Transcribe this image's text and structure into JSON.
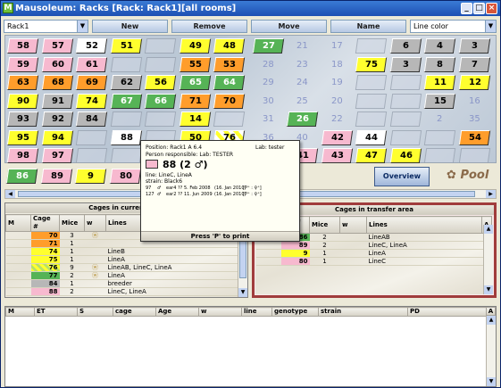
{
  "window": {
    "title": "Mausoleum: Racks [Rack: Rack1][all rooms]",
    "app_icon": "M",
    "minimize": "_",
    "maximize": "□",
    "close": "×"
  },
  "toolbar": {
    "rack_select": "Rack1",
    "rack_arrow": "▼",
    "new_label": "New",
    "remove_label": "Remove",
    "move_label": "Move",
    "name_label": "Name",
    "color_select": "Line color",
    "color_arrow": "▼"
  },
  "colors": {
    "pink": "#f7b9cf",
    "yellow": "#ffff2e",
    "orange": "#ff9d2b",
    "green": "#56b356",
    "gray": "#b7b7b7",
    "white": "#ffffff"
  },
  "rack": {
    "rows": [
      [
        "58:pink",
        "57:pink",
        "52:white",
        "51:yellow",
        ":empty",
        "49:yellow",
        "48:yellow",
        "27:green",
        "21:ghost",
        "17:ghost",
        ":empty",
        "6:gray",
        "4:gray",
        "3:gray"
      ],
      [
        "59:pink",
        "60:pink",
        "61:pink",
        ":empty",
        ":empty",
        "55:orange",
        "53:orange",
        "28:ghost",
        "23:ghost",
        "18:ghost",
        "75:yellow",
        "3:gray",
        "8:gray",
        "7:gray"
      ],
      [
        "63:orange",
        "68:orange",
        "69:orange",
        "62:gray",
        "56:yellow",
        "65:green",
        "64:green",
        "29:ghost",
        "24:ghost",
        "19:ghost",
        ":empty",
        ":empty",
        "11:yellow",
        "12:yellow"
      ],
      [
        "90:yellow",
        "91:gray",
        "74:yellow",
        "67:green",
        "66:green",
        "71:orange",
        "70:orange",
        "30:ghost",
        "25:ghost",
        "20:ghost",
        ":empty",
        ":empty",
        "15:gray",
        "16:ghost"
      ],
      [
        "93:gray",
        "92:gray",
        "84:gray",
        ":empty",
        ":empty",
        "14:yellow",
        ":empty",
        "31:ghost",
        "26:green",
        "22:ghost",
        ":empty",
        ":empty",
        "2:ghost",
        "35:ghost"
      ],
      [
        "95:yellow",
        "94:yellow",
        ":empty",
        "88:white",
        ":empty",
        "50:yellow",
        "76:stripe",
        "36:ghost",
        "40:ghost",
        "42:pink",
        "44:white",
        ":empty",
        ":empty",
        "54:orange"
      ],
      [
        "98:pink",
        "97:pink",
        ":empty",
        ":empty",
        ":empty",
        ":empty",
        ":empty",
        "39:ghost",
        "41:pink",
        "43:pink",
        "47:yellow",
        "46:yellow",
        ":empty",
        ":empty"
      ]
    ],
    "transfer": [
      "86:green",
      "89:pink",
      "9:yellow",
      "80:pink"
    ]
  },
  "overview_label": "Overview",
  "pool_label": "Pool",
  "popup": {
    "position": "Position: Rack1 A 6.4",
    "lab": "Lab: tester",
    "person": "Person responsible: Lab: TESTER",
    "cage_title": "88 (2 ♂)",
    "line": "line:  LineC, LineA",
    "strain": "strain: Black6",
    "mice": [
      {
        "id": "97",
        "sex": "♂",
        "ear": "ear4 ??",
        "born": "5. Feb 2008",
        "age": "(16. Jan 2010)",
        "gt": "[P⁺ : ♀⁺]"
      },
      {
        "id": "127",
        "sex": "♂",
        "ear": "ear2 ??",
        "born": "11. Jun 2009",
        "age": "(16. Jan 2010)",
        "gt": "[P⁺ : ♀⁺]"
      }
    ],
    "print_label": "Press 'P' to print"
  },
  "cages_current": {
    "title": "Cages in current rack",
    "headers": [
      "M",
      "Cage #",
      "Mice",
      "w",
      "Lines"
    ],
    "rows": [
      {
        "cage": "70",
        "color": "orange",
        "mice": "3",
        "w": "ⓦ",
        "lines": ""
      },
      {
        "cage": "71",
        "color": "orange",
        "mice": "1",
        "w": "",
        "lines": ""
      },
      {
        "cage": "74",
        "color": "yellow",
        "mice": "1",
        "w": "",
        "lines": "LineB"
      },
      {
        "cage": "75",
        "color": "yellow",
        "mice": "1",
        "w": "",
        "lines": "LineA"
      },
      {
        "cage": "76",
        "color": "stripe",
        "mice": "9",
        "w": "ⓦ",
        "lines": "LineAB, LineC, LineA"
      },
      {
        "cage": "77",
        "color": "green",
        "mice": "2",
        "w": "ⓦ",
        "lines": "LineA"
      },
      {
        "cage": "84",
        "color": "gray",
        "mice": "1",
        "w": "",
        "lines": "breeder"
      },
      {
        "cage": "88",
        "color": "pink",
        "mice": "2",
        "w": "",
        "lines": "LineC, LineA"
      }
    ]
  },
  "cages_transfer": {
    "title": "Cages in transfer area",
    "headers": [
      "M",
      "Cage #",
      "Mice",
      "w",
      "Lines",
      "A"
    ],
    "rows": [
      {
        "cage": "86",
        "color": "green",
        "mice": "2",
        "w": "",
        "lines": "LineAB"
      },
      {
        "cage": "89",
        "color": "pink",
        "mice": "2",
        "w": "",
        "lines": "LineC, LineA"
      },
      {
        "cage": "9",
        "color": "yellow",
        "mice": "1",
        "w": "",
        "lines": "LineA"
      },
      {
        "cage": "80",
        "color": "pink",
        "mice": "1",
        "w": "",
        "lines": "LineC"
      }
    ]
  },
  "mouse_table": {
    "headers": [
      "M",
      "ET",
      "S",
      "cage",
      "Age",
      "w",
      "line",
      "genotype",
      "strain",
      "PD",
      "A"
    ]
  }
}
